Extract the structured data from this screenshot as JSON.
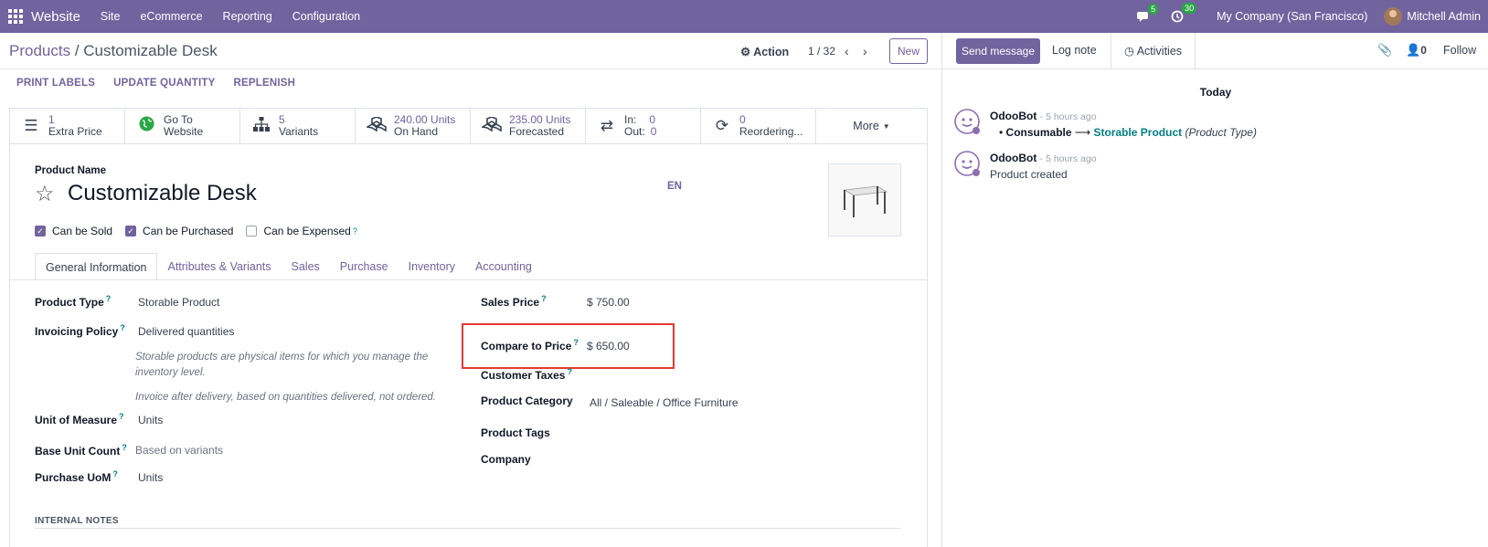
{
  "navbar": {
    "brand": "Website",
    "menus": [
      "Site",
      "eCommerce",
      "Reporting",
      "Configuration"
    ],
    "messages_count": "5",
    "activities_count": "30",
    "company": "My Company (San Francisco)",
    "user": "Mitchell Admin",
    "accent": "#71639e"
  },
  "control": {
    "breadcrumb_parent": "Products",
    "breadcrumb_sep": " / ",
    "breadcrumb_current": "Customizable Desk",
    "action_label": "Action",
    "pager": "1 / 32",
    "new_label": "New"
  },
  "header_buttons": [
    "PRINT LABELS",
    "UPDATE QUANTITY",
    "REPLENISH"
  ],
  "smart_buttons": [
    {
      "icon": "list-icon",
      "value": "1",
      "label": "Extra Price"
    },
    {
      "icon": "globe-icon",
      "value": "Go To",
      "label": "Website"
    },
    {
      "icon": "sitemap-icon",
      "value": "5",
      "label": "Variants"
    },
    {
      "icon": "cubes-icon",
      "value": "240.00 Units",
      "label": "On Hand"
    },
    {
      "icon": "cubes-icon",
      "value": "235.00 Units",
      "label": "Forecasted"
    },
    {
      "icon": "exchange-icon",
      "in_label": "In:",
      "in_value": "0",
      "out_label": "Out:",
      "out_value": "0"
    },
    {
      "icon": "refresh-icon",
      "value": "0",
      "label": "Reordering..."
    }
  ],
  "more_label": "More",
  "form": {
    "product_name_label": "Product Name",
    "product_name": "Customizable Desk",
    "lang": "EN",
    "checkboxes": [
      {
        "label": "Can be Sold",
        "checked": true
      },
      {
        "label": "Can be Purchased",
        "checked": true
      },
      {
        "label": "Can be Expensed",
        "checked": false
      }
    ],
    "tabs": [
      "General Information",
      "Attributes & Variants",
      "Sales",
      "Purchase",
      "Inventory",
      "Accounting"
    ],
    "left": {
      "product_type_label": "Product Type",
      "product_type": "Storable Product",
      "invoicing_policy_label": "Invoicing Policy",
      "invoicing_policy": "Delivered quantities",
      "help_1_line1": "Storable products are physical items for which you manage the",
      "help_1_line2": "inventory level.",
      "help_2": "Invoice after delivery, based on quantities delivered, not ordered.",
      "uom_label": "Unit of Measure",
      "uom": "Units",
      "base_unit_label": "Base Unit Count",
      "base_unit": "Based on variants",
      "purchase_uom_label": "Purchase UoM",
      "purchase_uom": "Units"
    },
    "right": {
      "sales_price_label": "Sales Price",
      "sales_price": "$ 750.00",
      "compare_price_label": "Compare to Price",
      "compare_price": "$ 650.00",
      "customer_taxes_label": "Customer Taxes",
      "category_label": "Product Category",
      "category": "All / Saleable / Office Furniture",
      "tags_label": "Product Tags",
      "company_label": "Company"
    },
    "internal_notes": "INTERNAL NOTES",
    "qmark": "?"
  },
  "chatter": {
    "send_message": "Send message",
    "log_note": "Log note",
    "activities": "Activities",
    "followers_count": "0",
    "follow": "Follow",
    "today": "Today",
    "messages": [
      {
        "author": "OdooBot",
        "date": "- 5 hours ago",
        "old": "Consumable",
        "arrow": "⟶",
        "new": "Storable Product",
        "field": "(Product Type)"
      },
      {
        "author": "OdooBot",
        "date": "- 5 hours ago",
        "body": "Product created"
      }
    ]
  }
}
